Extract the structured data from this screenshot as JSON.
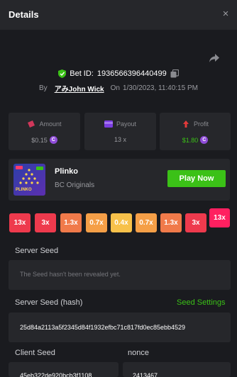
{
  "header": {
    "title": "Details",
    "close_icon": "×"
  },
  "bet": {
    "id_label": "Bet ID:",
    "id_value": "1936566396440499",
    "by_label": "By",
    "username": "アみJohn Wick",
    "on_label": "On",
    "datetime": "1/30/2023, 11:40:15 PM"
  },
  "stats": {
    "amount": {
      "label": "Amount",
      "value": "$0.15"
    },
    "payout": {
      "label": "Payout",
      "value": "13 x"
    },
    "profit": {
      "label": "Profit",
      "value": "$1.80"
    }
  },
  "colors": {
    "accent_green": "#3bc117",
    "coin_purple": "#8f4cd8",
    "slot_red": "#ee3a4d",
    "slot_orange": "#f07a4a",
    "slot_amber": "#f59f47",
    "slot_yellow": "#f7c14a",
    "slot_active": "#ff2060"
  },
  "game": {
    "name": "Plinko",
    "provider": "BC Originals",
    "play_label": "Play Now",
    "thumb_text": "PLINKO"
  },
  "multipliers": [
    {
      "label": "13x",
      "tone": "red"
    },
    {
      "label": "3x",
      "tone": "red"
    },
    {
      "label": "1.3x",
      "tone": "orange"
    },
    {
      "label": "0.7x",
      "tone": "amber"
    },
    {
      "label": "0.4x",
      "tone": "yellow"
    },
    {
      "label": "0.7x",
      "tone": "amber"
    },
    {
      "label": "1.3x",
      "tone": "orange"
    },
    {
      "label": "3x",
      "tone": "red"
    },
    {
      "label": "13x",
      "tone": "active"
    }
  ],
  "fairness": {
    "server_seed_label": "Server Seed",
    "server_seed_value": "The Seed hasn't been revealed yet.",
    "server_hash_label": "Server Seed (hash)",
    "seed_settings_label": "Seed Settings",
    "server_hash_value": "25d84a2113a5f2345d84f1932efbc71c817fd0ec85ebb4529",
    "client_seed_label": "Client Seed",
    "client_seed_value": "45eb322de920bcb3f1108",
    "nonce_label": "nonce",
    "nonce_value": "2413467"
  }
}
